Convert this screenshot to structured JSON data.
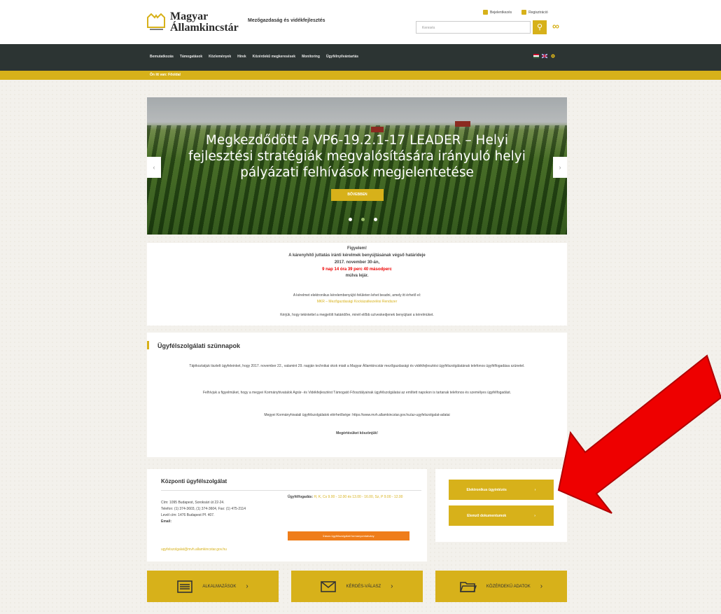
{
  "header": {
    "logo_line1": "Magyar",
    "logo_line2": "Államkincstár",
    "tagline": "Mezőgazdaság és vidékfejlesztés",
    "toplinks": [
      "Bejelentkezés",
      "Regisztráció"
    ],
    "search_placeholder": "Keresés",
    "search_icon": "search-icon",
    "rss_icon": "rss-icon"
  },
  "nav": {
    "items": [
      "Bemutatkozás",
      "Támogatások",
      "Közlemények",
      "Hírek",
      "Közérdekű megkeresések",
      "Monitoring",
      "Ügyfélnyilvántartás"
    ]
  },
  "breadcrumb": "Ön itt van: Főoldal",
  "hero": {
    "headline": "Megkezdődött a VP6-19.2.1-17 LEADER – Helyi fejlesztési stratégiák megvalósítására irányuló helyi pályázati felhívások megjelentetése",
    "more": "BŐVEBBEN",
    "prev": "‹",
    "next": "›"
  },
  "notice": {
    "line1": "Figyelem!",
    "line2": "A kárenyhítő juttatás iránti kérelmek benyújtásának végső határideje",
    "line3": "2017. november 30-án,",
    "line4": "9 nap 14 óra 39 perc 40 másodperc",
    "line5": "múlva lejár.",
    "line6": "A kérelmet elektronikus kérelembenyújtó felületen lehet beadni, amely itt érhető el:",
    "line7": "MKR – Mezőgazdasági Kockázatkezelési Rendszer",
    "line8": "Kérjük, hogy tekintettel a megjelölt határidőre, minél előbb szíveskedjenek benyújtani a kérelmüket."
  },
  "closure": {
    "title": "Ügyfélszolgálati szünnapok",
    "p1": "Tájékoztatjuk tisztelt ügyfeleinket, hogy 2017. november 22., valamint 29. napján technikai okok miatt a Magyar Államkincstár mezőgazdasági és vidékfejlesztési ügyfélszolgálatának telefonos ügyfélfogadása szünetel.",
    "p2": "Felhívjuk a figyelmüket, hogy a megyei Kormányhivatalok Agrár- és Vidékfejlesztést Támogató Főosztályainak ügyfélszolgálatai az említett napokon is tartanak telefonos és személyes ügyfélfogadást.",
    "p3": "Megyei Kormányhivatali ügyfélszolgálatok elérhetősége: https://www.mvh.allamkincstar.gov.hu/az-ugyfelszolgalat-adatai",
    "p4": "Megértésüket köszönjük!"
  },
  "central": {
    "title": "Központi ügyfélszolgálat",
    "address": "Cím: 1095 Budapest, Soroksári út 22-24.",
    "phone": "Telefon: (1) 374-3603, (1) 374-3604, Fax: (1) 475-2114",
    "mail": "Levél cím: 1476 Budapest Pf. 407.",
    "email_label": "Email:",
    "email": "ugyfelszolgalat@mvh.allamkincstar.gov.hu",
    "hours_label": "Ügyfélfogadás:",
    "hours_text": "H, K, Cs 9.00 - 12.00 és 13.00 - 16.00, Sz, P 9.00 - 12.00",
    "orange_btn": "Írásos ügyfélszolgálati formanyomtatvány"
  },
  "side": {
    "btn1": "Elektronikus ügyintézés",
    "btn2": "Elemző dokumentumok"
  },
  "bottom": [
    {
      "label": "ALKALMAZÁSOK",
      "icon": "list-icon"
    },
    {
      "label": "KÉRDÉS-VÁLASZ",
      "icon": "envelope-icon"
    },
    {
      "label": "KÖZÉRDEKŰ ADATOK",
      "icon": "folder-icon"
    }
  ],
  "colors": {
    "brand": "#d7b11a",
    "nav": "#2c3433",
    "alert": "#e00000",
    "annotation": "#ee0000"
  }
}
